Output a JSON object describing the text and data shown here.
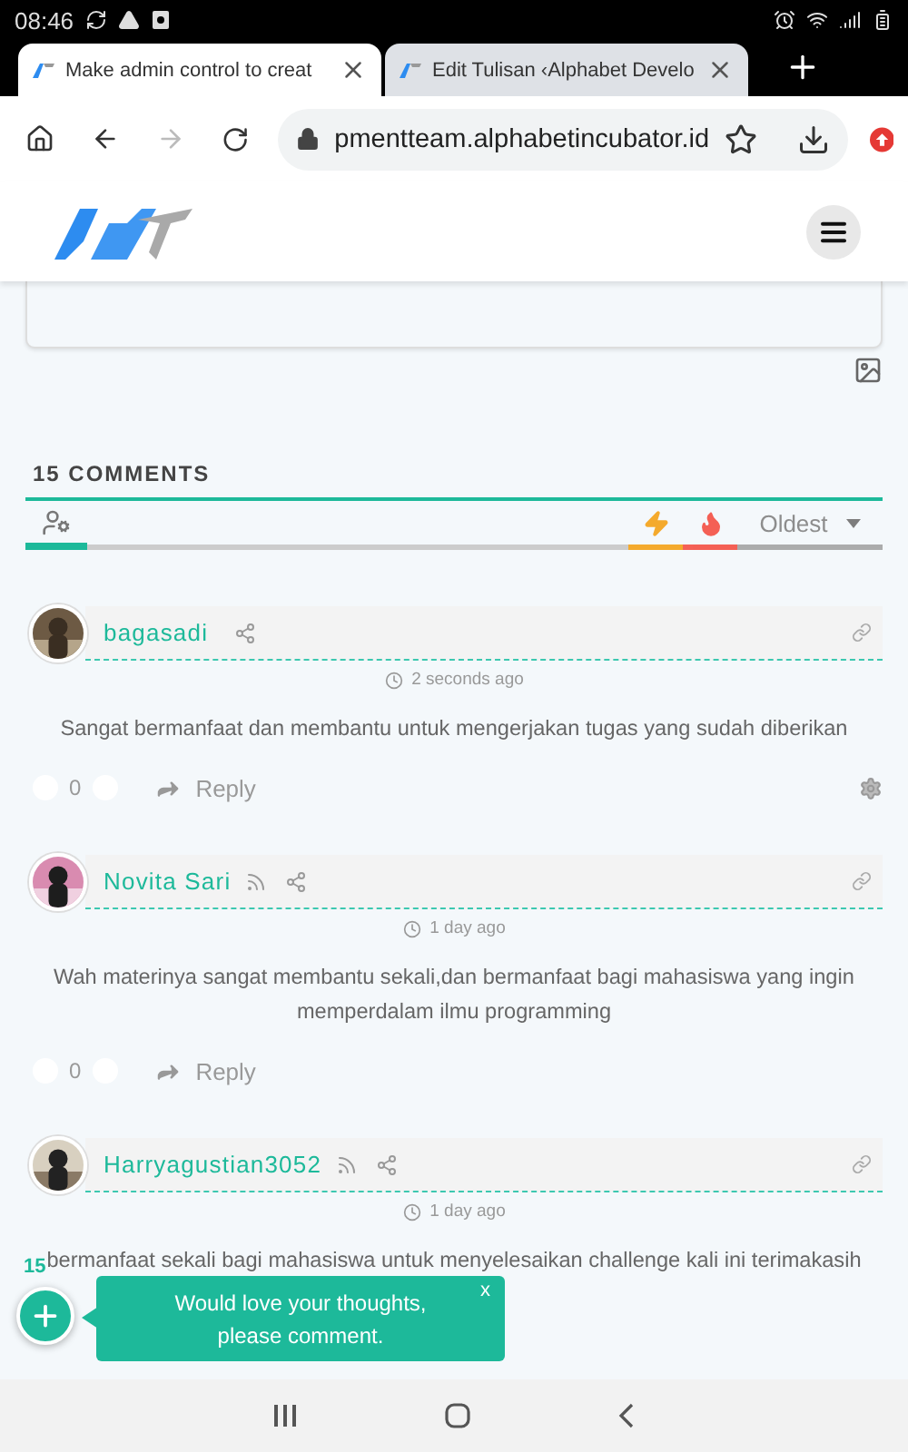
{
  "status_bar": {
    "time": "08:46"
  },
  "tabs": [
    {
      "title": "Make admin control to creat",
      "selected": true
    },
    {
      "title": "Edit Tulisan ‹Alphabet Develo",
      "selected": false
    }
  ],
  "address_bar": {
    "url": "pmentteam.alphabetincubator.id"
  },
  "comments_section": {
    "heading": "15 COMMENTS",
    "filters": [
      {
        "kind": "authors",
        "selected": true,
        "color": "#1db99a"
      },
      {
        "kind": "trending",
        "selected": false,
        "color": "#f5a623"
      },
      {
        "kind": "hot",
        "selected": false,
        "color": "#f4584d"
      },
      {
        "kind": "sort",
        "selected": false,
        "label": "Oldest",
        "color": "#a8a8a8"
      }
    ],
    "comments": [
      {
        "author": "bagasadi",
        "rss": false,
        "time": "2 seconds ago",
        "text": "Sangat bermanfaat dan membantu untuk mengerjakan tugas yang sudah diberikan",
        "votes": "0",
        "reply": "Reply",
        "editable": true
      },
      {
        "author": "Novita Sari",
        "rss": true,
        "time": "1 day ago",
        "text": "Wah materinya sangat membantu sekali,dan bermanfaat bagi mahasiswa yang ingin memperdalam ilmu programming",
        "votes": "0",
        "reply": "Reply",
        "editable": false
      },
      {
        "author": "Harryagustian3052",
        "rss": true,
        "time": "1 day ago",
        "text": "bermanfaat sekali bagi mahasiswa untuk menyelesaikan challenge kali ini terimakasih",
        "editable": false
      }
    ]
  },
  "comment_bubble": {
    "count": "15",
    "message": "Would love your thoughts, please comment.",
    "close": "x"
  }
}
